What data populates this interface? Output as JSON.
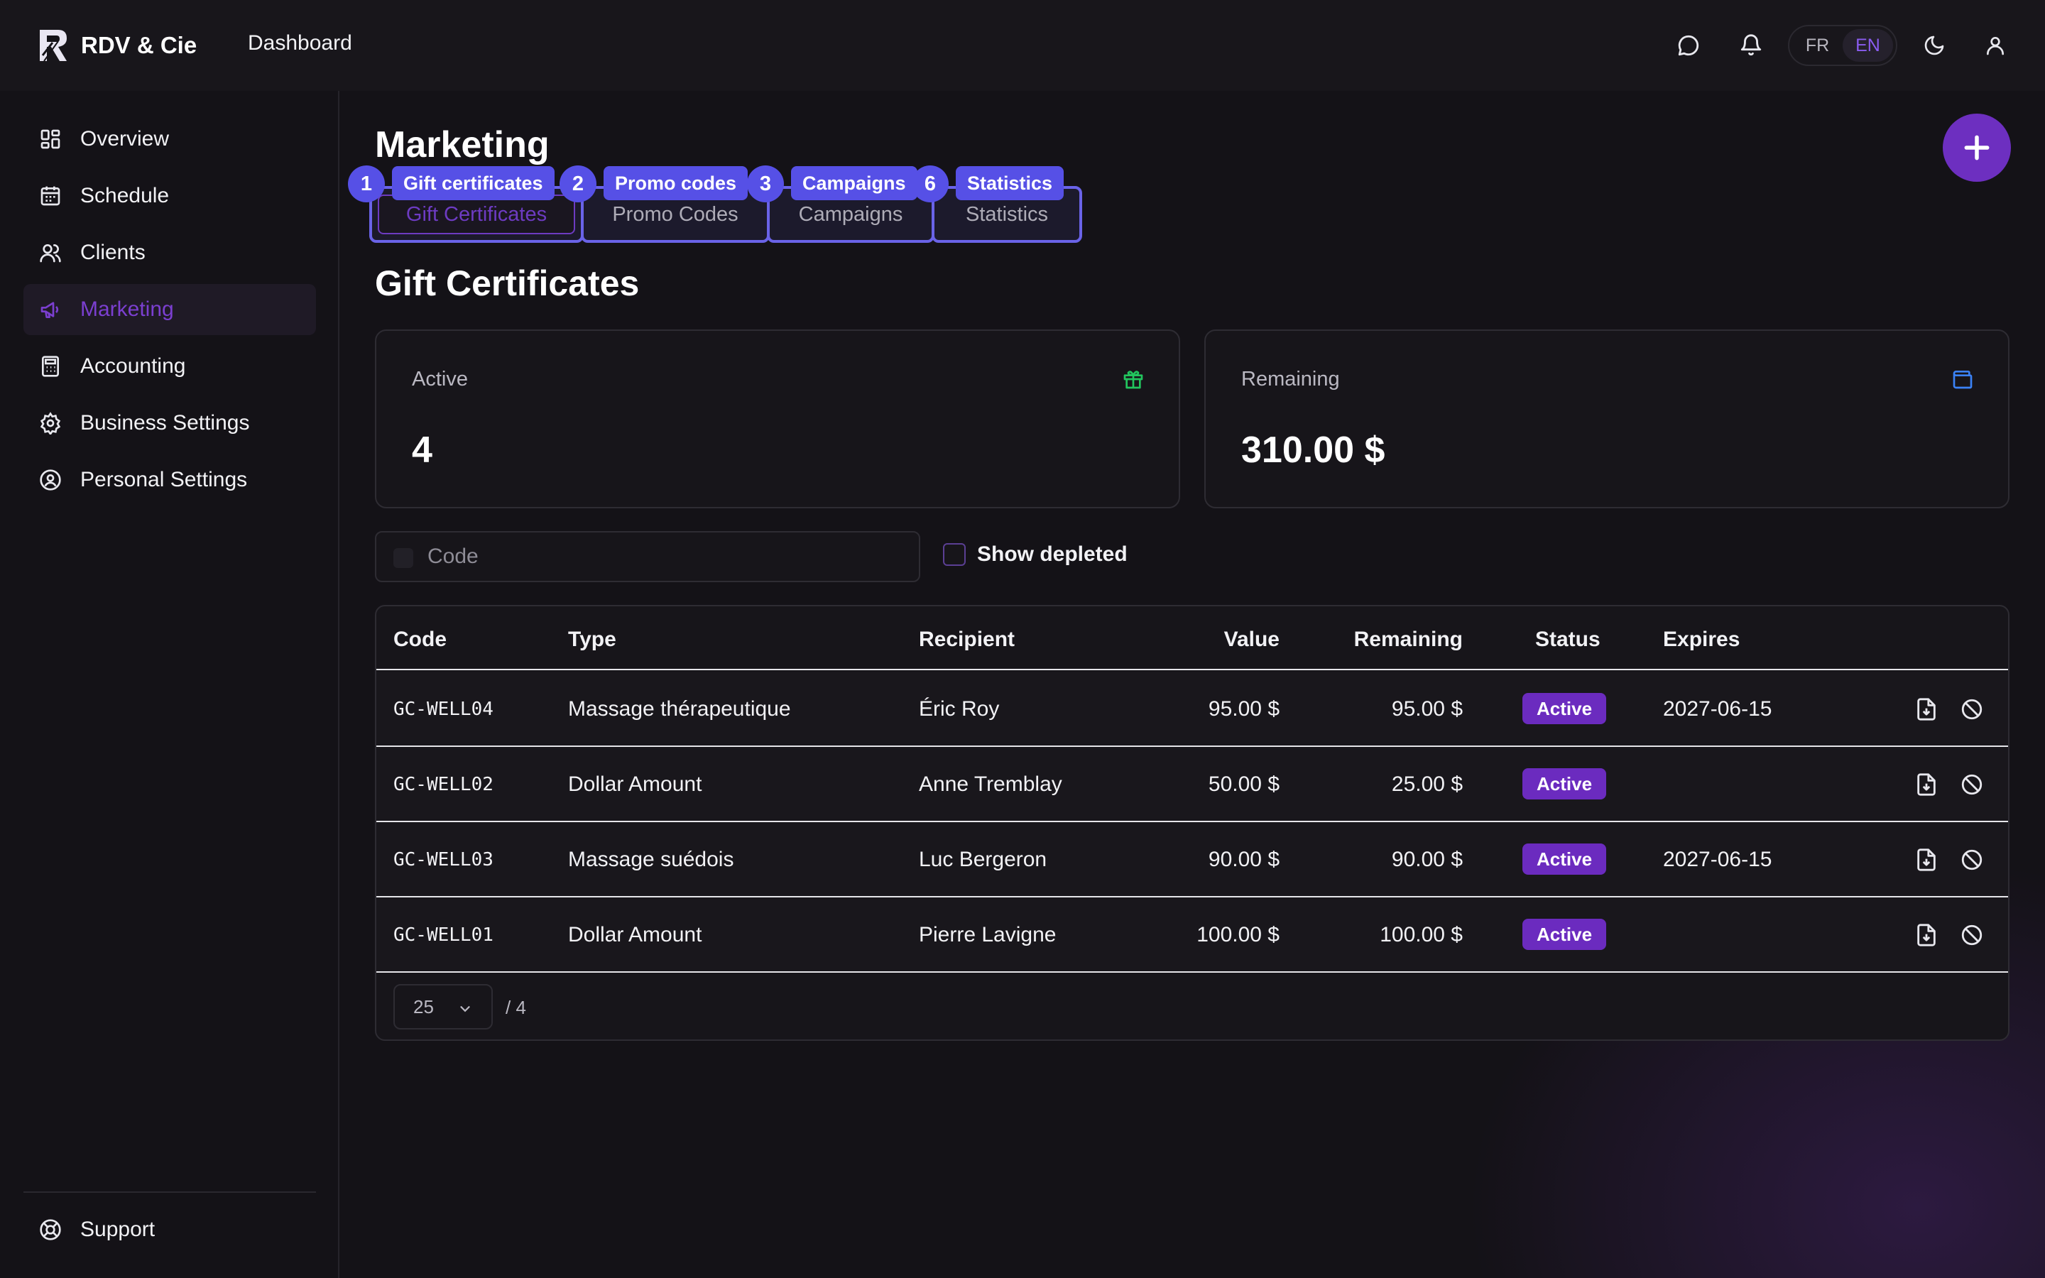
{
  "app": {
    "brand": "RDV & Cie",
    "top_link": "Dashboard"
  },
  "topbar": {
    "lang_fr": "FR",
    "lang_en": "EN"
  },
  "sidebar": {
    "items": [
      {
        "label": "Overview",
        "icon": "grid-icon"
      },
      {
        "label": "Schedule",
        "icon": "calendar-icon"
      },
      {
        "label": "Clients",
        "icon": "users-icon"
      },
      {
        "label": "Marketing",
        "icon": "megaphone-icon",
        "active": true
      },
      {
        "label": "Accounting",
        "icon": "calculator-icon"
      },
      {
        "label": "Business Settings",
        "icon": "gear-icon"
      },
      {
        "label": "Personal Settings",
        "icon": "user-circle-icon"
      }
    ],
    "support": "Support"
  },
  "page": {
    "title": "Marketing",
    "tabs": [
      {
        "label": "Gift Certificates",
        "badge": "Gift certificates",
        "num": "1",
        "active": true
      },
      {
        "label": "Promo Codes",
        "badge": "Promo codes",
        "num": "2"
      },
      {
        "label": "Campaigns",
        "badge": "Campaigns",
        "num": "3"
      },
      {
        "label": "Statistics",
        "badge": "Statistics",
        "num": "6"
      }
    ],
    "section_title": "Gift Certificates"
  },
  "cards": {
    "active": {
      "label": "Active",
      "value": "4"
    },
    "remaining": {
      "label": "Remaining",
      "value": "310.00 $"
    }
  },
  "filters": {
    "search_placeholder": "Code",
    "show_depleted": "Show depleted"
  },
  "table": {
    "headers": {
      "code": "Code",
      "type": "Type",
      "recipient": "Recipient",
      "value": "Value",
      "remaining": "Remaining",
      "status": "Status",
      "expires": "Expires"
    },
    "rows": [
      {
        "code": "GC-WELL04",
        "type": "Massage thérapeutique",
        "recipient": "Éric Roy",
        "value": "95.00 $",
        "remaining": "95.00 $",
        "status": "Active",
        "expires": "2027-06-15"
      },
      {
        "code": "GC-WELL02",
        "type": "Dollar Amount",
        "recipient": "Anne Tremblay",
        "value": "50.00 $",
        "remaining": "25.00 $",
        "status": "Active",
        "expires": ""
      },
      {
        "code": "GC-WELL03",
        "type": "Massage suédois",
        "recipient": "Luc Bergeron",
        "value": "90.00 $",
        "remaining": "90.00 $",
        "status": "Active",
        "expires": "2027-06-15"
      },
      {
        "code": "GC-WELL01",
        "type": "Dollar Amount",
        "recipient": "Pierre Lavigne",
        "value": "100.00 $",
        "remaining": "100.00 $",
        "status": "Active",
        "expires": ""
      }
    ],
    "page_size": "25",
    "total": "/ 4"
  },
  "colors": {
    "accent": "#6d2fc0",
    "overlay": "#5650e6",
    "status_active": "#6b2bbf"
  }
}
